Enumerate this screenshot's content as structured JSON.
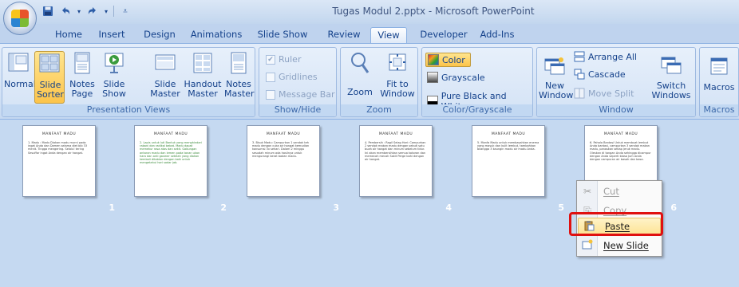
{
  "window": {
    "title": "Tugas Modul 2.pptx - Microsoft PowerPoint"
  },
  "qat": {
    "icons": [
      "save-icon",
      "undo-icon",
      "redo-icon",
      "customize-icon"
    ]
  },
  "tabs": [
    "Home",
    "Insert",
    "Design",
    "Animations",
    "Slide Show",
    "Review",
    "View",
    "Developer",
    "Add-Ins"
  ],
  "active_tab": "View",
  "ribbon": {
    "presentation_views": {
      "label": "Presentation Views",
      "buttons": [
        "Normal",
        "Slide Sorter",
        "Notes Page",
        "Slide Show",
        "Slide Master",
        "Handout Master",
        "Notes Master"
      ]
    },
    "show_hide": {
      "label": "Show/Hide",
      "ruler": "Ruler",
      "gridlines": "Gridlines",
      "message_bar": "Message Bar"
    },
    "zoom": {
      "label": "Zoom",
      "zoom": "Zoom",
      "fit_to_window": "Fit to Window"
    },
    "color": {
      "label": "Color/Grayscale",
      "color": "Color",
      "grayscale": "Grayscale",
      "pure_bw": "Pure Black and White"
    },
    "window": {
      "label": "Window",
      "new_window": "New Window",
      "arrange_all": "Arrange All",
      "cascade": "Cascade",
      "move_split": "Move Split",
      "switch_windows": "Switch Windows"
    },
    "macros": {
      "label": "Macros",
      "macros": "Macros"
    }
  },
  "slides": [
    {
      "num": "1",
      "title": "MANFAAT MADU",
      "body": "1. Madu : Madu  Diakan madu murni pada ingat  Anda dan  Damen selama diet bib 33 menit. Tingga mengering. Selalu! tering Sesuffar ingat  Anda dengan air hangat."
    },
    {
      "num": "2",
      "title": "MANFAAT MADU",
      "body": "2. Lapis untuk luti  Bantuk yang menghindari rabani dan radikal bebat. Madu dapat memekur rasa atas dan sekit. Gabungan antaran madu dan iemen pada tanan ukan hara dan anti gasmer setelah yang diakan kembali ditabian dengan baik untuk mengetahui hari sadar jab."
    },
    {
      "num": "3",
      "title": "MANFAAT MADU",
      "body": "3. Bisuk Madu: Campurkan 1 sendok teh madu dengan cuka air hangat kemudian konsumsi 3x sehari. Dalam 2 minggu sesudah minum ada hasilnya untuk mengurangi berat badan madu."
    },
    {
      "num": "4",
      "title": "MANFAAT MADU",
      "body": "4. Pembersih : Ragil Selag Hari: Campurkan 2 sendok makan madu dengan sebuti satu buah air hangat dan minum sebelum tidur. Ini akan membersihkan semua kotoran dan memecah mecah Sakit Perge bahi dengan air hangat."
    },
    {
      "num": "5",
      "title": "MANFAAT MADU",
      "body": "5. Manfa Madu untuk membasahkan enema yang masuk dan kulit lembut, tambahkan bilangga 3 kaungin madu air madu Anda."
    },
    {
      "num": "6",
      "title": "MANFAAT MADU",
      "body": "6. Pahala Bantasi Untuk membuat lembut Anda bantasi, campurkan 3 sendok makan madu, panaskan setiap jeruk madu. Oleskan di tangan Anda sehingga dicampur dengan Anda seperti biasa Jum Anda dengan campuran air basah dan basa."
    }
  ],
  "context_menu": {
    "items": [
      {
        "label": "Cut",
        "icon": "scissors-icon",
        "disabled": true
      },
      {
        "label": "Copy",
        "icon": "copy-icon",
        "disabled": true
      },
      {
        "label": "Paste",
        "icon": "paste-icon",
        "disabled": false
      },
      {
        "label": "New Slide",
        "icon": "new-slide-icon",
        "disabled": false
      }
    ]
  }
}
